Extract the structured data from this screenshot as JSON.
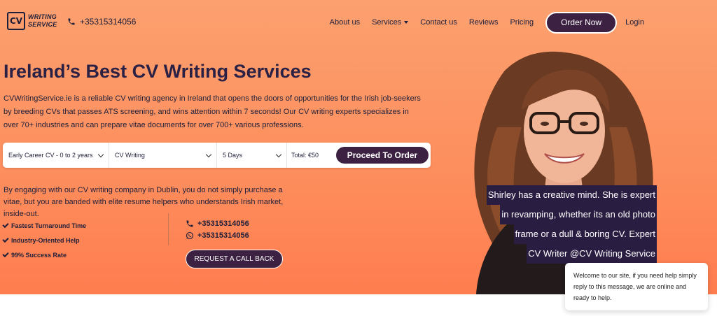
{
  "header": {
    "logo_mark": "CV",
    "logo_line1": "WRITING",
    "logo_line2": "SERVICE",
    "phone": "+35315314056"
  },
  "nav": {
    "about": "About us",
    "services": "Services",
    "contact": "Contact us",
    "reviews": "Reviews",
    "pricing": "Pricing",
    "order_now": "Order Now",
    "login": "Login"
  },
  "hero": {
    "title": "Ireland’s Best CV Writing Services",
    "intro": "CVWritingService.ie is a reliable CV writing agency in Ireland that opens the doors of opportunities for the Irish job-seekers by breeding CVs that passes ATS screening, and wins attention within 7 seconds! Our CV writing experts specializes in over 70+ industries and can prepare vitae documents for over 700+ various professions."
  },
  "order_bar": {
    "level": "Early Career CV - 0 to 2 years",
    "service": "CV Writing",
    "delivery": "5 Days",
    "total": "Total: €50",
    "proceed": "Proceed To Order"
  },
  "engage_text": "By engaging with our CV writing company in Dublin, you do not simply purchase a vitae, but you are banded with elite resume helpers who understands Irish market, inside-out.",
  "features": [
    "Fastest Turnaround Time",
    "Industry-Oriented Help",
    "99% Success Rate"
  ],
  "contacts": {
    "phone": "+35315314056",
    "whatsapp": "+35315314056",
    "callback": "REQUEST A CALL BACK"
  },
  "quote_lines": [
    "Shirley has a creative mind. She is expert",
    "in revamping, whether its an old photo",
    "frame or a dull & boring CV. Expert",
    "CV Writer @CV Writing Service"
  ],
  "chat": {
    "message": "Welcome to our site, if you need help simply reply to this message, we are online and ready to help."
  },
  "colors": {
    "accent": "#3d2142",
    "hero_top": "#fca06f",
    "hero_bottom": "#ff7d50",
    "text_dark": "#1e1f3a"
  },
  "icons": {
    "phone": "phone-icon",
    "whatsapp": "whatsapp-icon",
    "check": "check-icon",
    "chevron": "chevron-down-icon"
  }
}
